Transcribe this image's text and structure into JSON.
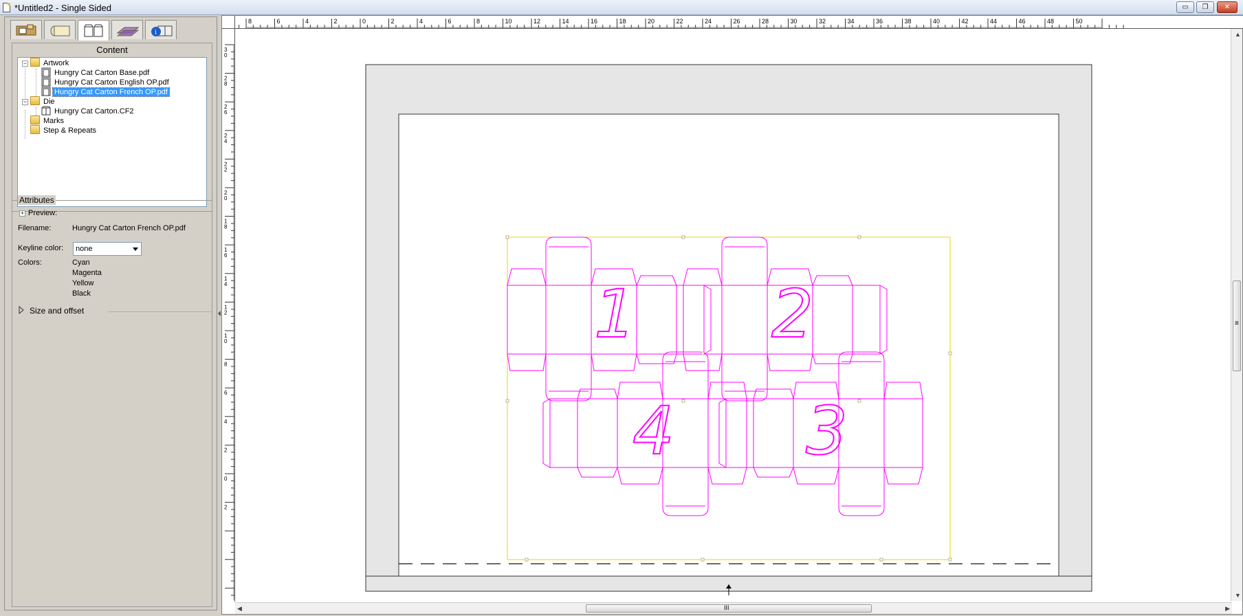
{
  "window": {
    "title": "*Untitled2 - Single Sided",
    "controls": {
      "minimize": "▭",
      "restore": "❐",
      "close": "✕"
    }
  },
  "tabs": [
    {
      "icon": "job-folder-icon"
    },
    {
      "icon": "media-roll-icon"
    },
    {
      "icon": "content-cartons-icon"
    },
    {
      "icon": "marks-layers-icon"
    },
    {
      "icon": "info-cartons-icon"
    }
  ],
  "content": {
    "title": "Content",
    "tree": [
      {
        "label": "Artwork",
        "type": "folder",
        "level": 0,
        "expander": "−"
      },
      {
        "label": "Hungry Cat Carton Base.pdf",
        "type": "file",
        "level": 1
      },
      {
        "label": "Hungry Cat Carton English OP.pdf",
        "type": "file",
        "level": 1
      },
      {
        "label": "Hungry Cat Carton French OP.pdf",
        "type": "file",
        "level": 1,
        "selected": true
      },
      {
        "label": "Die",
        "type": "folder",
        "level": 0,
        "expander": "−"
      },
      {
        "label": "Hungry Cat Carton.CF2",
        "type": "die-file",
        "level": 1
      },
      {
        "label": "Marks",
        "type": "folder",
        "level": 0
      },
      {
        "label": "Step & Repeats",
        "type": "folder",
        "level": 0
      }
    ]
  },
  "attributes": {
    "title": "Attributes",
    "preview_label": "Preview:",
    "preview_expander": "+",
    "filename_label": "Filename:",
    "filename_value": "Hungry Cat Carton French OP.pdf",
    "keyline_label": "Keyline color:",
    "keyline_value": "none",
    "colors_label": "Colors:",
    "colors": [
      "Cyan",
      "Magenta",
      "Yellow",
      "Black"
    ],
    "size_offset_label": "Size and offset"
  },
  "ruler": {
    "top_labels": [
      "8",
      "6",
      "4",
      "2",
      "0",
      "2",
      "4",
      "6",
      "8",
      "10",
      "12",
      "14",
      "16",
      "18",
      "20",
      "22",
      "24",
      "26",
      "28",
      "30",
      "32",
      "34",
      "36",
      "38",
      "40",
      "42",
      "44",
      "46",
      "48",
      "50"
    ],
    "left_labels": [
      "3",
      "2",
      "2",
      "2",
      "2",
      "2",
      "1",
      "1",
      "1",
      "1",
      "1",
      "8",
      "6",
      "4",
      "2",
      "0",
      "2"
    ],
    "left_sub": [
      "0",
      "8",
      "6",
      "4",
      "2",
      "0",
      "8",
      "6",
      "4",
      "2",
      "0",
      "",
      "",
      "",
      "",
      "",
      ""
    ]
  },
  "carton_numbers": [
    "1",
    "2",
    "4",
    "3"
  ],
  "colors": {
    "dieline": "#ff00ff",
    "bleed_box": "#f2d400",
    "sheet_gray": "#e6e6e6",
    "selection": "#3399ff"
  },
  "scroll_grip": "III",
  "scroll_grip_v": "≡"
}
